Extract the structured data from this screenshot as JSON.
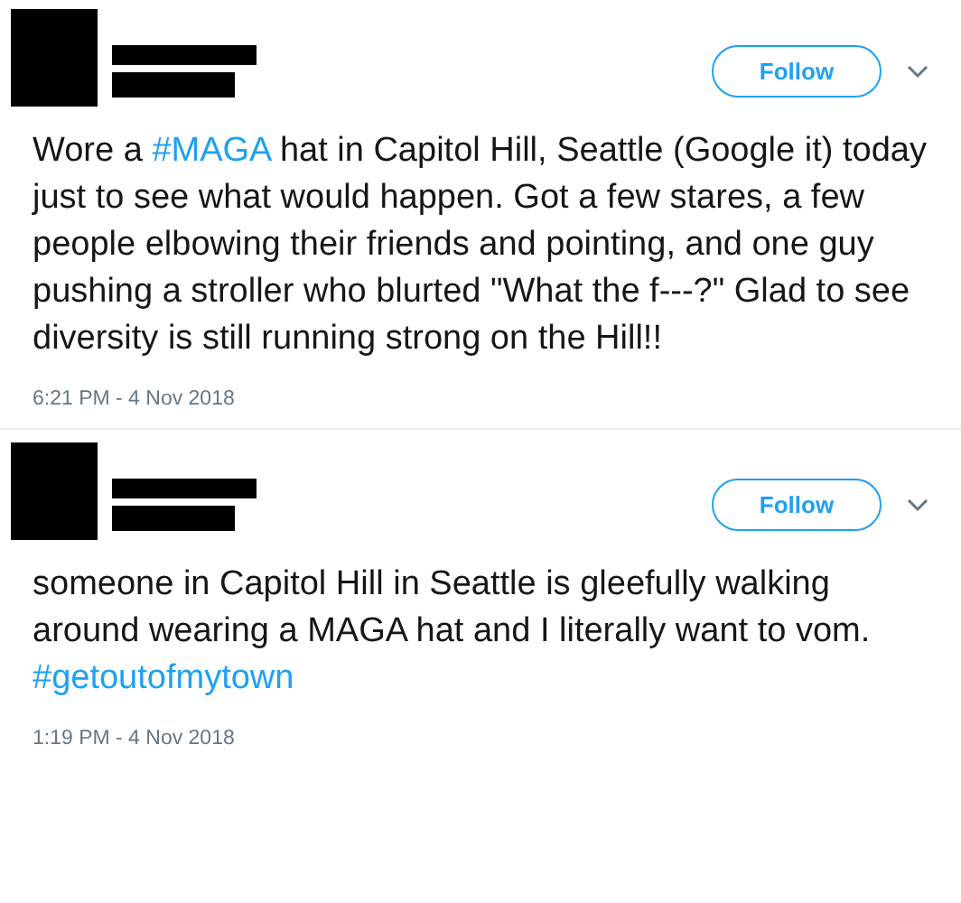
{
  "tweets": [
    {
      "follow_button": "Follow",
      "text_parts": [
        {
          "kind": "text",
          "text": "Wore a "
        },
        {
          "kind": "hashtag",
          "text": "#MAGA"
        },
        {
          "kind": "text",
          "text": " hat in Capitol Hill, Seattle (Google it) today just to see what would happen. Got a few stares, a few people elbowing their friends and pointing, and one guy pushing a stroller who blurted \"What the f---?\" Glad to see diversity is still running strong on the Hill!!"
        }
      ],
      "timestamp": "6:21 PM - 4 Nov 2018"
    },
    {
      "follow_button": "Follow",
      "text_parts": [
        {
          "kind": "text",
          "text": "someone in Capitol Hill in Seattle is gleefully walking around wearing a MAGA hat and I literally want to vom. "
        },
        {
          "kind": "hashtag",
          "text": "#getoutofmytown"
        }
      ],
      "timestamp": "1:19 PM - 4 Nov 2018"
    }
  ]
}
